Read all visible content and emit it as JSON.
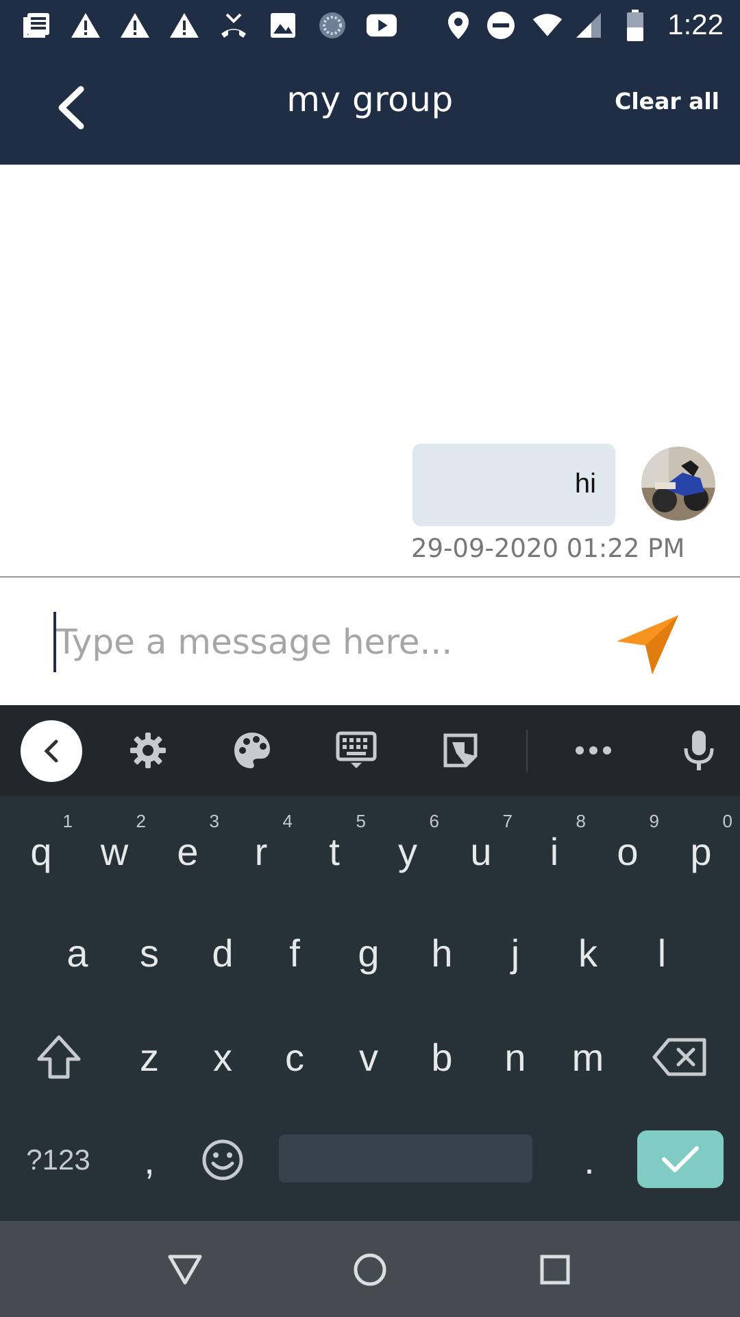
{
  "status_bar": {
    "time": "1:22",
    "left_icons": [
      "news-icon",
      "warning-icon",
      "warning-icon",
      "warning-icon",
      "missed-call-icon",
      "image-icon",
      "loading-icon",
      "youtube-icon"
    ],
    "right_icons": [
      "location-icon",
      "do-not-disturb-icon",
      "wifi-icon",
      "signal-icon",
      "battery-icon"
    ]
  },
  "header": {
    "title": "my group",
    "clear_label": "Clear all",
    "background": "#1f2d45"
  },
  "messages": [
    {
      "text": "hi",
      "timestamp": "29-09-2020 01:22 PM",
      "sender": "me"
    }
  ],
  "composer": {
    "placeholder": "Type a message here...",
    "value": "",
    "send_color": "#f7931e"
  },
  "keyboard": {
    "toolbar_icons": [
      "chevron-left-icon",
      "gear-icon",
      "palette-icon",
      "keyboard-icon",
      "sticker-icon",
      "more-icon",
      "microphone-icon"
    ],
    "row1": [
      "q",
      "w",
      "e",
      "r",
      "t",
      "y",
      "u",
      "i",
      "o",
      "p"
    ],
    "row1_hints": [
      "1",
      "2",
      "3",
      "4",
      "5",
      "6",
      "7",
      "8",
      "9",
      "0"
    ],
    "row2": [
      "a",
      "s",
      "d",
      "f",
      "g",
      "h",
      "j",
      "k",
      "l"
    ],
    "row3": [
      "z",
      "x",
      "c",
      "v",
      "b",
      "n",
      "m"
    ],
    "symbols_label": "?123",
    "comma": ",",
    "period": ".",
    "enter_color": "#80cbc4"
  },
  "nav_bar": {
    "buttons": [
      "back-triangle-icon",
      "home-circle-icon",
      "recents-square-icon"
    ]
  }
}
